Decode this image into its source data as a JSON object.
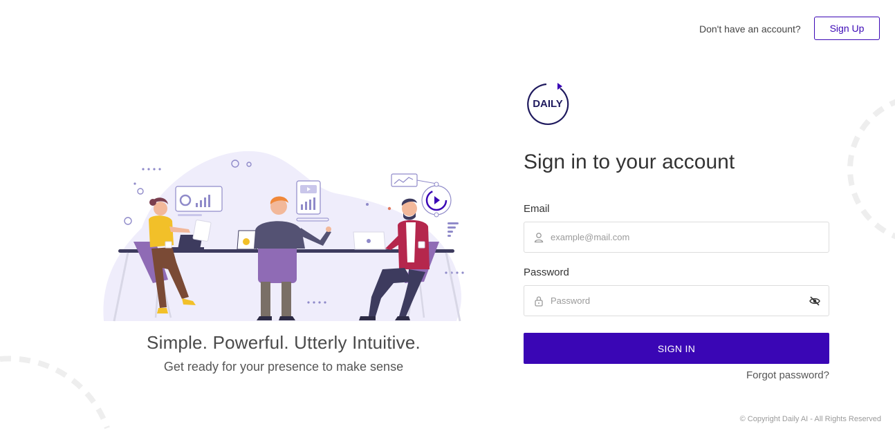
{
  "header": {
    "prompt": "Don't have an account?",
    "signup_label": "Sign Up"
  },
  "hero": {
    "tagline": "Simple. Powerful. Utterly Intuitive.",
    "subtagline": "Get ready for your presence to make sense"
  },
  "brand": {
    "logo_text": "DAILY",
    "accent_color": "#3a06b5"
  },
  "form": {
    "title": "Sign in to your account",
    "email_label": "Email",
    "email_placeholder": "example@mail.com",
    "email_value": "",
    "password_label": "Password",
    "password_placeholder": "Password",
    "password_value": "",
    "submit_label": "SIGN IN",
    "forgot_label": "Forgot password?",
    "icons": {
      "email": "user-icon",
      "password": "lock-icon",
      "toggle": "eye-slash-icon"
    }
  },
  "footer": {
    "copyright": "© Copyright Daily AI - All Rights Reserved"
  }
}
